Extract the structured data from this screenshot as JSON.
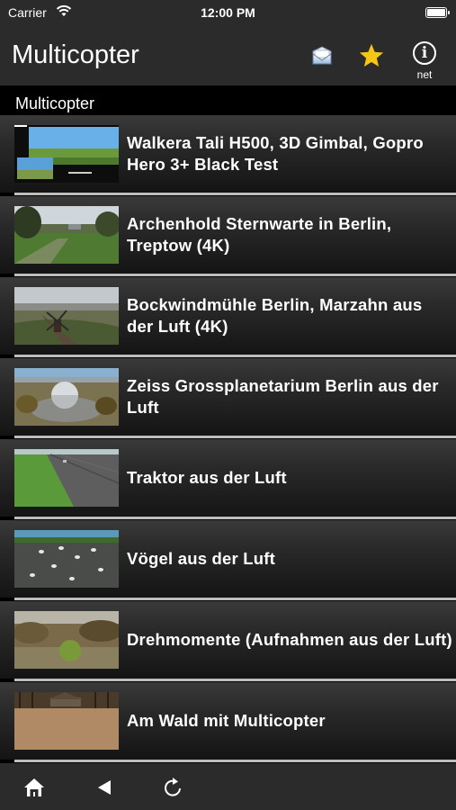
{
  "status_bar": {
    "carrier": "Carrier",
    "time": "12:00 PM"
  },
  "nav": {
    "title": "Multicopter",
    "info_sub": "net",
    "info_glyph": "i"
  },
  "section": {
    "title": "Multicopter"
  },
  "items": [
    {
      "title": "Walkera Tali H500, 3D Gimbal, Gopro Hero 3+ Black Test",
      "thumb": "thumb-screen-test"
    },
    {
      "title": "Archenhold Sternwarte in Berlin, Treptow (4K)",
      "thumb": "thumb-park-trees"
    },
    {
      "title": "Bockwindmühle Berlin, Marzahn aus der Luft (4K)",
      "thumb": "thumb-windmill"
    },
    {
      "title": "Zeiss Grossplanetarium Berlin aus der Luft",
      "thumb": "thumb-planetarium"
    },
    {
      "title": "Traktor aus der Luft",
      "thumb": "thumb-field"
    },
    {
      "title": "Vögel aus der Luft",
      "thumb": "thumb-birds"
    },
    {
      "title": "Drehmomente (Aufnahmen aus der Luft)",
      "thumb": "thumb-autumn-field"
    },
    {
      "title": "Am Wald mit Multicopter",
      "thumb": "thumb-forest-edge"
    }
  ],
  "icons": {
    "share": "share-icon",
    "favorite": "star-icon",
    "info": "info-icon",
    "home": "home-icon",
    "back": "back-icon",
    "reload": "reload-icon"
  },
  "colors": {
    "star": "#f5c518",
    "bar": "#2b2b2b",
    "separator": "#bdbdbd"
  }
}
